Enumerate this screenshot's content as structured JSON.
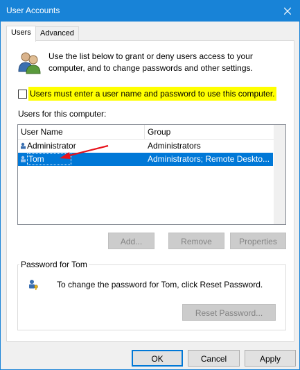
{
  "window": {
    "title": "User Accounts",
    "close_icon": "close-icon"
  },
  "tabs": [
    {
      "label": "Users",
      "active": true
    },
    {
      "label": "Advanced",
      "active": false
    }
  ],
  "intro": {
    "text": "Use the list below to grant or deny users access to your computer, and to change passwords and other settings."
  },
  "checkbox": {
    "label": "Users must enter a user name and password to use this computer.",
    "checked": false,
    "highlight": "#ffff00"
  },
  "users_list": {
    "label": "Users for this computer:",
    "columns": [
      "User Name",
      "Group"
    ],
    "rows": [
      {
        "name": "Administrator",
        "group": "Administrators",
        "selected": false
      },
      {
        "name": "Tom",
        "group": "Administrators; Remote Deskto...",
        "selected": true
      }
    ]
  },
  "list_buttons": {
    "add": "Add...",
    "remove": "Remove",
    "properties": "Properties"
  },
  "password_group": {
    "legend": "Password for Tom",
    "text": "To change the password for Tom, click Reset Password.",
    "reset_button": "Reset Password..."
  },
  "footer": {
    "ok": "OK",
    "cancel": "Cancel",
    "apply": "Apply"
  },
  "colors": {
    "titlebar": "#1883d7",
    "selection": "#0078d7",
    "annotation_arrow": "#e8131c"
  }
}
